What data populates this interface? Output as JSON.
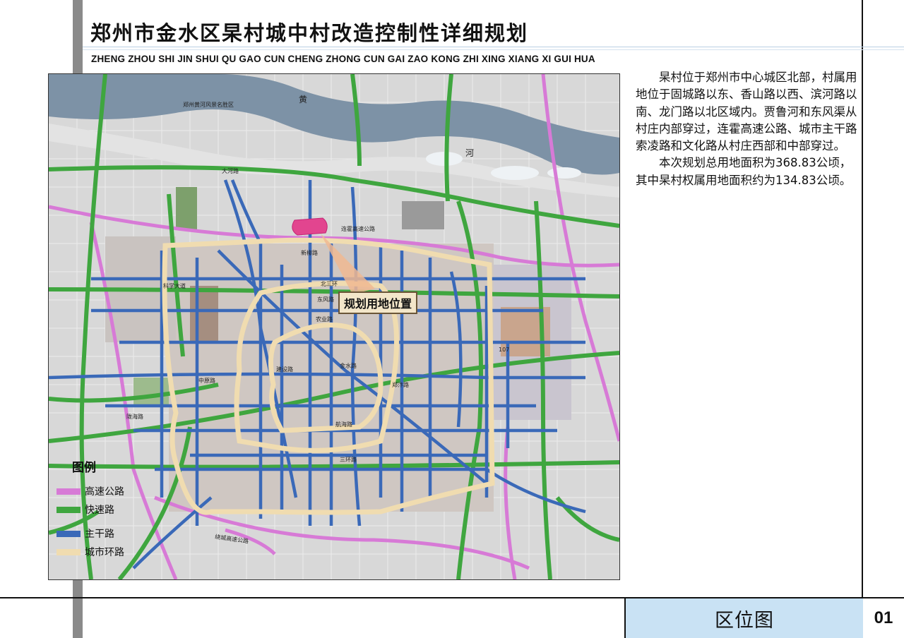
{
  "header": {
    "title": "郑州市金水区杲村城中村改造控制性详细规划",
    "subtitle": "ZHENG ZHOU SHI JIN SHUI QU GAO CUN CHENG ZHONG CUN GAI ZAO KONG ZHI XING XIANG XI GUI HUA"
  },
  "description": {
    "paragraphs": [
      "杲村位于郑州市中心城区北部，村属用地位于固城路以东、香山路以西、滨河路以南、龙门路以北区域内。贾鲁河和东风渠从村庄内部穿过，连霍高速公路、城市主干路索凌路和文化路从村庄西部和中部穿过。",
      "本次规划总用地面积为368.83公顷，其中杲村权属用地面积约为134.83公顷。"
    ]
  },
  "map": {
    "site_label": "规划用地位置",
    "labels": {
      "dahe": "大河路",
      "lianhuo": "连霍高速公路",
      "xinliu": "新柳路",
      "beisanhuan": "北三环",
      "dongfeng": "东风路",
      "nongye": "农业路",
      "jinshui": "金水路",
      "kexue": "科学大道",
      "zhongyuan": "中原路",
      "longhai": "陇海路",
      "hanghai": "航海路",
      "sanhuan": "三环路",
      "zhengbian": "郑汴路",
      "jianshe": "建设路",
      "raocheng": "绕城高速公路",
      "huanghe_scenic": "郑州黄河风景名胜区",
      "river_huang": "黄",
      "river_he": "河",
      "highway_107": "107"
    },
    "legend": {
      "title": "图例",
      "items": [
        {
          "label": "高速公路",
          "color": "#d77ad6"
        },
        {
          "label": "快速路",
          "color": "#3fa63f"
        },
        {
          "label": "主干路",
          "color": "#3a69b8"
        },
        {
          "label": "城市环路",
          "color": "#f0dcb0"
        }
      ]
    }
  },
  "footer": {
    "drawing_name": "区位图",
    "page_number": "01"
  }
}
